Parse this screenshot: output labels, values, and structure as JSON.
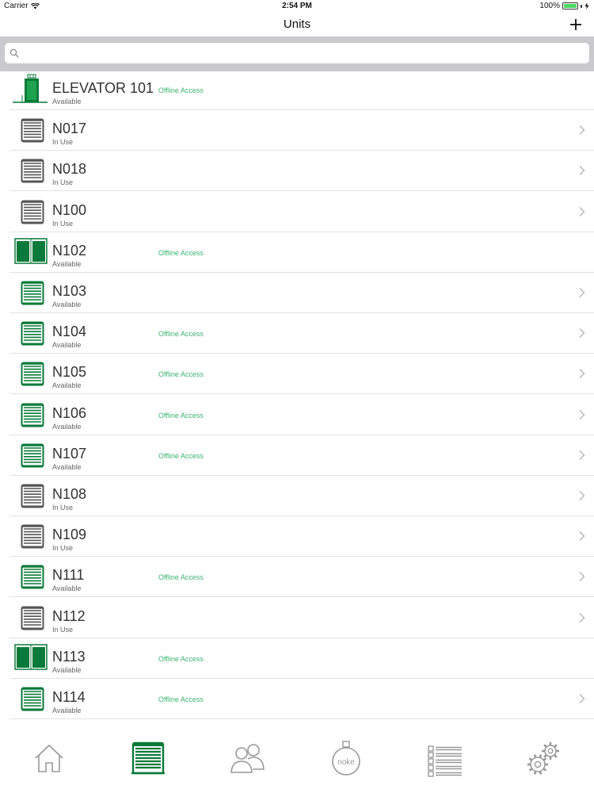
{
  "status_bar": {
    "carrier": "Carrier",
    "time": "2:54 PM",
    "battery": "100%"
  },
  "nav": {
    "title": "Units"
  },
  "search": {
    "placeholder": ""
  },
  "colors": {
    "accent_green": "#0a7a3a",
    "offline_green": "#3cb371",
    "in_use_gray": "#555555"
  },
  "units": [
    {
      "name": "ELEVATOR 101",
      "status": "Available",
      "offline": "Offline Access",
      "icon": "elevator-icon",
      "chevron": false
    },
    {
      "name": "N017",
      "status": "In Use",
      "offline": "",
      "icon": "storage-door-gray-icon",
      "chevron": true
    },
    {
      "name": "N018",
      "status": "In Use",
      "offline": "",
      "icon": "storage-door-gray-icon",
      "chevron": true
    },
    {
      "name": "N100",
      "status": "In Use",
      "offline": "",
      "icon": "storage-door-gray-icon",
      "chevron": true
    },
    {
      "name": "N102",
      "status": "Available",
      "offline": "Offline Access",
      "icon": "double-door-icon",
      "chevron": false
    },
    {
      "name": "N103",
      "status": "Available",
      "offline": "",
      "icon": "storage-door-green-icon",
      "chevron": true
    },
    {
      "name": "N104",
      "status": "Available",
      "offline": "Offline Access",
      "icon": "storage-door-green-icon",
      "chevron": true
    },
    {
      "name": "N105",
      "status": "Available",
      "offline": "Offline Access",
      "icon": "storage-door-green-icon",
      "chevron": true
    },
    {
      "name": "N106",
      "status": "Available",
      "offline": "Offline Access",
      "icon": "storage-door-green-icon",
      "chevron": true
    },
    {
      "name": "N107",
      "status": "Available",
      "offline": "Offline Access",
      "icon": "storage-door-green-icon",
      "chevron": true
    },
    {
      "name": "N108",
      "status": "In Use",
      "offline": "",
      "icon": "storage-door-gray-icon",
      "chevron": true
    },
    {
      "name": "N109",
      "status": "In Use",
      "offline": "",
      "icon": "storage-door-gray-icon",
      "chevron": true
    },
    {
      "name": "N111",
      "status": "Available",
      "offline": "Offline Access",
      "icon": "storage-door-green-icon",
      "chevron": true
    },
    {
      "name": "N112",
      "status": "In Use",
      "offline": "",
      "icon": "storage-door-gray-icon",
      "chevron": true
    },
    {
      "name": "N113",
      "status": "Available",
      "offline": "Offline Access",
      "icon": "double-door-icon",
      "chevron": false
    },
    {
      "name": "N114",
      "status": "Available",
      "offline": "Offline Access",
      "icon": "storage-door-green-icon",
      "chevron": true
    }
  ],
  "tabs": [
    {
      "icon": "home-icon",
      "active": false
    },
    {
      "icon": "units-icon",
      "active": true
    },
    {
      "icon": "users-icon",
      "active": false
    },
    {
      "icon": "noke-lock-icon",
      "label": "noke",
      "active": false
    },
    {
      "icon": "activity-list-icon",
      "active": false
    },
    {
      "icon": "settings-gears-icon",
      "active": false
    }
  ]
}
